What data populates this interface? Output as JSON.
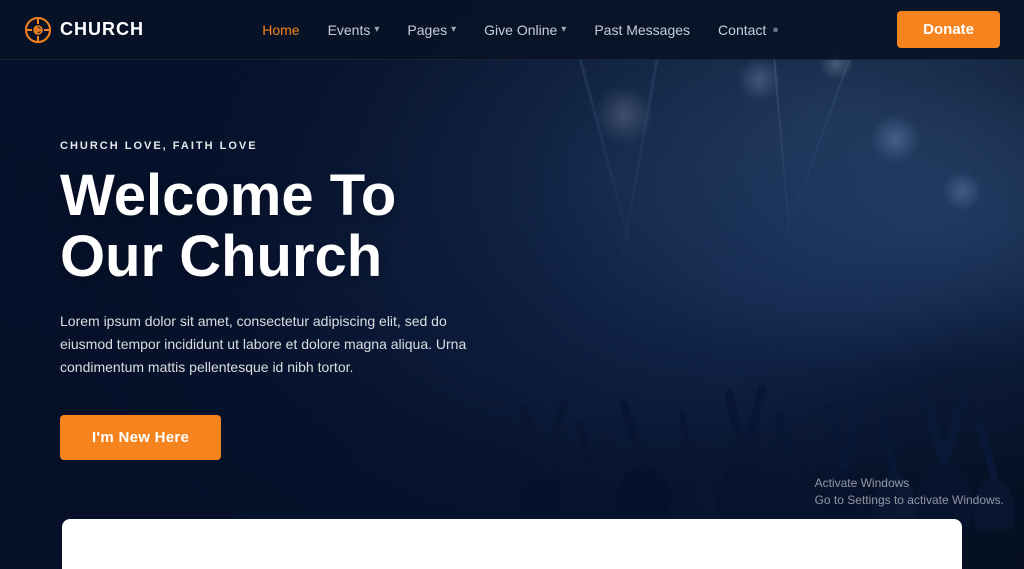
{
  "site": {
    "name": "CHURCH"
  },
  "navbar": {
    "logo_text": "CHURCH",
    "donate_label": "Donate",
    "links": [
      {
        "label": "Home",
        "active": true,
        "has_dropdown": false
      },
      {
        "label": "Events",
        "active": false,
        "has_dropdown": true
      },
      {
        "label": "Pages",
        "active": false,
        "has_dropdown": true
      },
      {
        "label": "Give Online",
        "active": false,
        "has_dropdown": true
      },
      {
        "label": "Past Messages",
        "active": false,
        "has_dropdown": false
      },
      {
        "label": "Contact",
        "active": false,
        "has_dropdown": false
      }
    ]
  },
  "hero": {
    "subtitle": "CHURCH LOVE, FAITH LOVE",
    "title_line1": "Welcome To",
    "title_line2": "Our Church",
    "description": "Lorem ipsum dolor sit amet, consectetur adipiscing elit, sed do eiusmod tempor incididunt ut labore et dolore magna aliqua. Urna condimentum mattis pellentesque id nibh tortor.",
    "cta_label": "I'm New Here"
  },
  "watermark": {
    "line1": "Activate Windows",
    "line2": "Go to Settings to activate Windows."
  },
  "colors": {
    "accent": "#f5841f",
    "nav_bg": "rgba(8,18,38,0.92)",
    "hero_bg": "#0a1628"
  }
}
